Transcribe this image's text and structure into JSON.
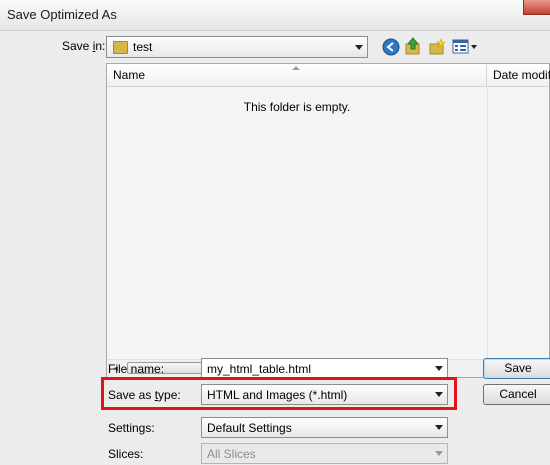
{
  "window": {
    "title": "Save Optimized As"
  },
  "save_in": {
    "label_pre": "Save ",
    "label_key": "i",
    "label_post": "n:",
    "value": "test"
  },
  "list": {
    "columns": [
      "Name",
      "Date modified"
    ],
    "empty_message": "This folder is empty.",
    "scroll_grip": "III"
  },
  "file_name": {
    "label": "File name:",
    "value": "my_html_table.html"
  },
  "save_as_type": {
    "label_pre": "Save as ",
    "label_key": "t",
    "label_post": "ype:",
    "value": "HTML and Images (*.html)"
  },
  "settings": {
    "label": "Settings:",
    "value": "Default Settings"
  },
  "slices": {
    "label": "Slices:",
    "value": "All Slices"
  },
  "buttons": {
    "save": "Save",
    "cancel": "Cancel"
  },
  "icons": [
    "folder-icon",
    "back-icon",
    "up-folder-icon",
    "new-folder-icon",
    "views-icon"
  ]
}
